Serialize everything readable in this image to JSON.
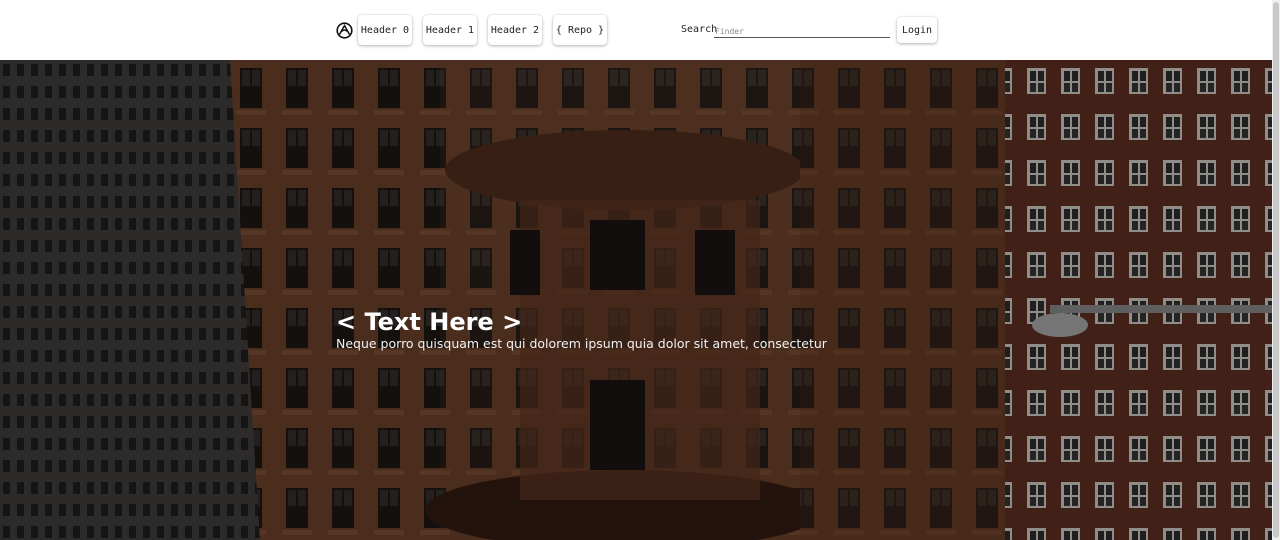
{
  "nav": {
    "logo_icon": "circle-logo-icon",
    "buttons": [
      "Header 0",
      "Header 1",
      "Header 2",
      "{ Repo }"
    ],
    "search": {
      "label": "Search",
      "placeholder": "Finder",
      "value": ""
    },
    "login_label": "Login"
  },
  "hero": {
    "title": "< Text Here >",
    "subtitle": "Neque porro quisquam est qui dolorem ipsum quia dolor sit amet, consectetur",
    "background": "city-buildings-photo"
  },
  "colors": {
    "header_bg": "#ffffff",
    "hero_overlay": "rgba(0,0,0,0.38)",
    "brick": "#6e3f2a",
    "dark_building": "#3c3a3a"
  }
}
